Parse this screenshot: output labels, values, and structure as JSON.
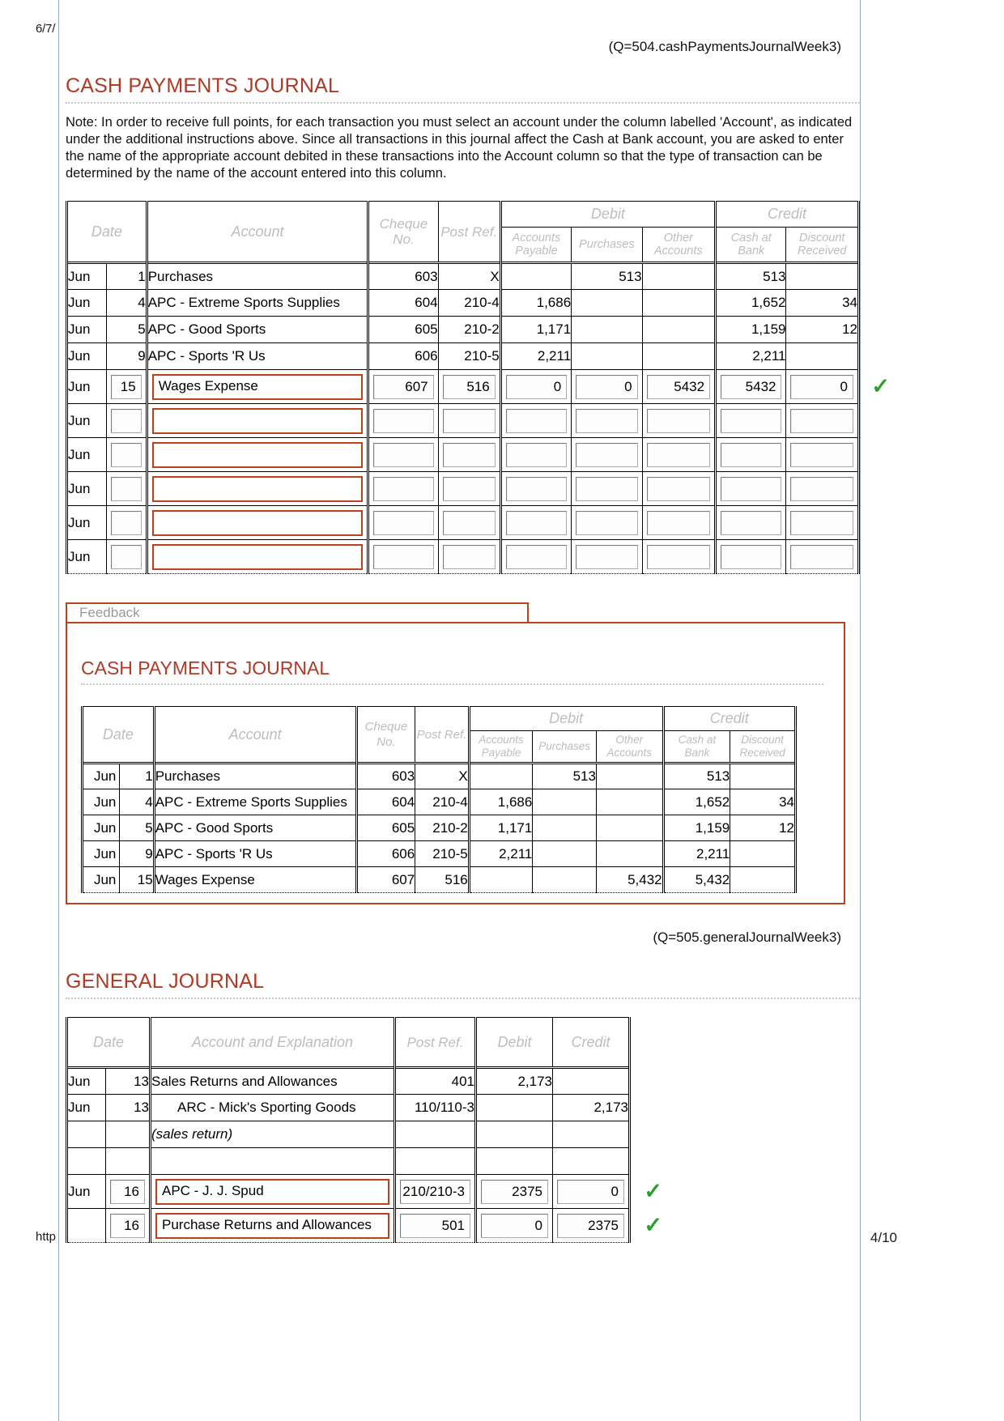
{
  "page": {
    "header_left": "6/7/",
    "footer_left": "http",
    "footer_right": "4/10"
  },
  "cash_payments": {
    "qtag": "(Q=504.cashPaymentsJournalWeek3)",
    "title": "CASH PAYMENTS JOURNAL",
    "note": "Note: In order to receive full points, for each transaction you must select an account under the column labelled 'Account', as indicated under the additional instructions above. Since all transactions in this journal affect the Cash at Bank account, you are asked to enter the name of the appropriate account debited in these transactions into the Account column so that the type of transaction can be determined by the name of the account entered into this column.",
    "headers": {
      "date": "Date",
      "account": "Account",
      "cheque_no": "Cheque No.",
      "post_ref": "Post Ref.",
      "debit": "Debit",
      "credit": "Credit",
      "accounts_payable": "Accounts Payable",
      "purchases": "Purchases",
      "other_accounts": "Other Accounts",
      "cash_at_bank": "Cash at Bank",
      "discount_received": "Discount Received"
    },
    "rows": [
      {
        "month": "Jun",
        "day": "1",
        "account": "Purchases",
        "cheque": "603",
        "ref": "X",
        "ap": "",
        "purch": "513",
        "other": "",
        "cash": "513",
        "disc": ""
      },
      {
        "month": "Jun",
        "day": "4",
        "account": "APC - Extreme Sports Supplies",
        "cheque": "604",
        "ref": "210-4",
        "ap": "1,686",
        "purch": "",
        "other": "",
        "cash": "1,652",
        "disc": "34"
      },
      {
        "month": "Jun",
        "day": "5",
        "account": "APC - Good Sports",
        "cheque": "605",
        "ref": "210-2",
        "ap": "1,171",
        "purch": "",
        "other": "",
        "cash": "1,159",
        "disc": "12"
      },
      {
        "month": "Jun",
        "day": "9",
        "account": "APC - Sports 'R Us",
        "cheque": "606",
        "ref": "210-5",
        "ap": "2,211",
        "purch": "",
        "other": "",
        "cash": "2,211",
        "disc": ""
      }
    ],
    "entry_rows": [
      {
        "month": "Jun",
        "day": "15",
        "account": "Wages Expense",
        "cheque": "607",
        "ref": "516",
        "ap": "0",
        "purch": "0",
        "other": "5432",
        "cash": "5432",
        "disc": "0",
        "correct": true
      },
      {
        "month": "Jun",
        "day": "",
        "account": "",
        "cheque": "",
        "ref": "",
        "ap": "",
        "purch": "",
        "other": "",
        "cash": "",
        "disc": "",
        "correct": false
      },
      {
        "month": "Jun",
        "day": "",
        "account": "",
        "cheque": "",
        "ref": "",
        "ap": "",
        "purch": "",
        "other": "",
        "cash": "",
        "disc": "",
        "correct": false
      },
      {
        "month": "Jun",
        "day": "",
        "account": "",
        "cheque": "",
        "ref": "",
        "ap": "",
        "purch": "",
        "other": "",
        "cash": "",
        "disc": "",
        "correct": false
      },
      {
        "month": "Jun",
        "day": "",
        "account": "",
        "cheque": "",
        "ref": "",
        "ap": "",
        "purch": "",
        "other": "",
        "cash": "",
        "disc": "",
        "correct": false
      },
      {
        "month": "Jun",
        "day": "",
        "account": "",
        "cheque": "",
        "ref": "",
        "ap": "",
        "purch": "",
        "other": "",
        "cash": "",
        "disc": "",
        "correct": false
      }
    ]
  },
  "feedback": {
    "legend": "Feedback",
    "title": "CASH PAYMENTS JOURNAL",
    "rows": [
      {
        "month": "Jun",
        "day": "1",
        "account": "Purchases",
        "cheque": "603",
        "ref": "X",
        "ap": "",
        "purch": "513",
        "other": "",
        "cash": "513",
        "disc": ""
      },
      {
        "month": "Jun",
        "day": "4",
        "account": "APC - Extreme Sports Supplies",
        "cheque": "604",
        "ref": "210-4",
        "ap": "1,686",
        "purch": "",
        "other": "",
        "cash": "1,652",
        "disc": "34"
      },
      {
        "month": "Jun",
        "day": "5",
        "account": "APC - Good Sports",
        "cheque": "605",
        "ref": "210-2",
        "ap": "1,171",
        "purch": "",
        "other": "",
        "cash": "1,159",
        "disc": "12"
      },
      {
        "month": "Jun",
        "day": "9",
        "account": "APC - Sports 'R Us",
        "cheque": "606",
        "ref": "210-5",
        "ap": "2,211",
        "purch": "",
        "other": "",
        "cash": "2,211",
        "disc": ""
      },
      {
        "month": "Jun",
        "day": "15",
        "account": "Wages Expense",
        "cheque": "607",
        "ref": "516",
        "ap": "",
        "purch": "",
        "other": "5,432",
        "cash": "5,432",
        "disc": ""
      }
    ]
  },
  "general_journal": {
    "qtag": "(Q=505.generalJournalWeek3)",
    "title": "GENERAL JOURNAL",
    "headers": {
      "date": "Date",
      "account_explanation": "Account and Explanation",
      "post_ref": "Post Ref.",
      "debit": "Debit",
      "credit": "Credit"
    },
    "rows": [
      {
        "month": "Jun",
        "day": "13",
        "account": "Sales Returns and Allowances",
        "indent": false,
        "italic": false,
        "ref": "401",
        "debit": "2,173",
        "credit": ""
      },
      {
        "month": "Jun",
        "day": "13",
        "account": "ARC - Mick's Sporting Goods",
        "indent": true,
        "italic": false,
        "ref": "110/110-3",
        "debit": "",
        "credit": "2,173"
      },
      {
        "month": "",
        "day": "",
        "account": "(sales return)",
        "indent": false,
        "italic": true,
        "ref": "",
        "debit": "",
        "credit": ""
      },
      {
        "month": "",
        "day": "",
        "account": "",
        "indent": false,
        "italic": false,
        "ref": "",
        "debit": "",
        "credit": ""
      }
    ],
    "entry_rows": [
      {
        "month": "Jun",
        "day": "16",
        "account": "APC - J. J. Spud",
        "ref": "210/210-3",
        "debit": "2375",
        "credit": "0",
        "correct": true
      },
      {
        "month": "",
        "day": "16",
        "account": "Purchase Returns and Allowances",
        "ref": "501",
        "debit": "0",
        "credit": "2375",
        "correct": true
      }
    ]
  }
}
